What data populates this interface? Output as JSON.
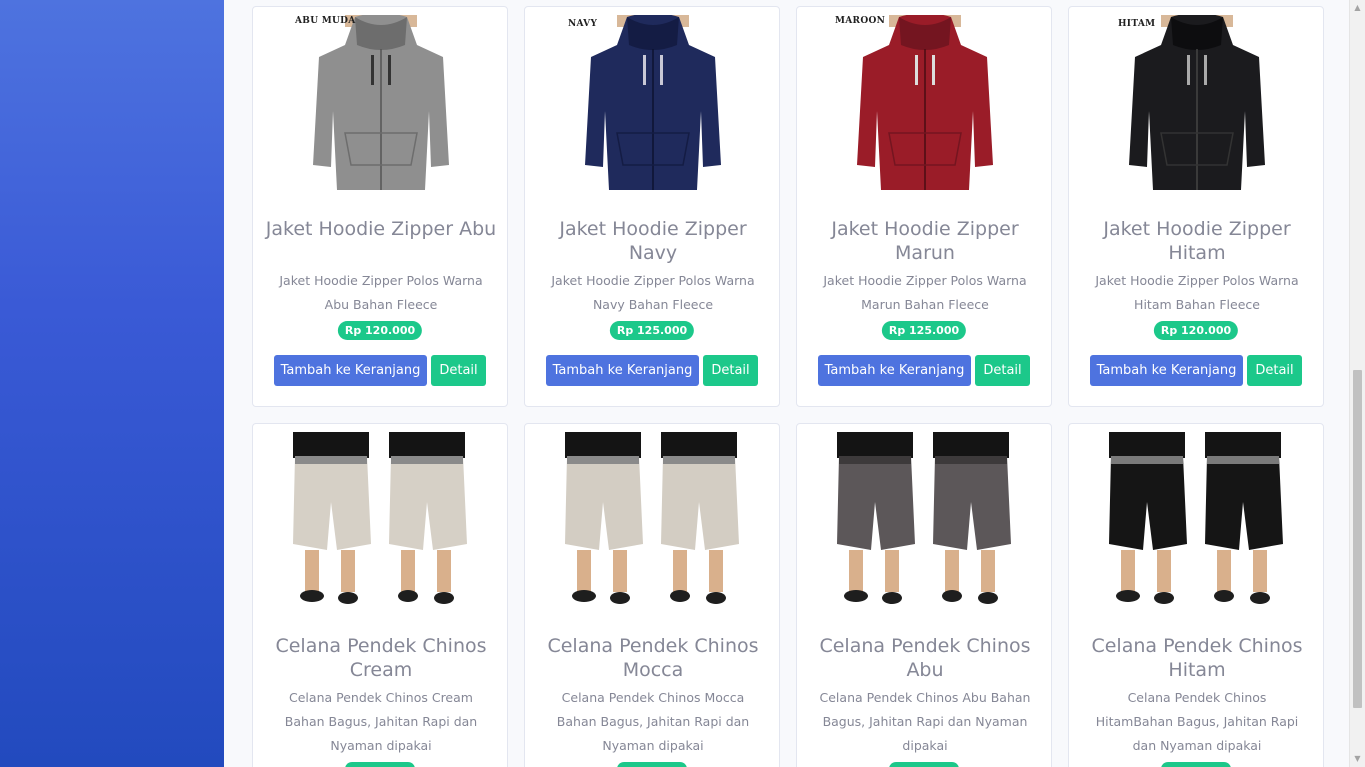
{
  "products_row1": [
    {
      "color_label": "ABU MUDA",
      "title": "Jaket Hoodie Zipper Abu",
      "desc": "Jaket Hoodie Zipper Polos Warna Abu Bahan Fleece",
      "price": "Rp 120.000",
      "hoodie_color": "#8f8f8f",
      "hoodie_shade": "#6d6d6d"
    },
    {
      "color_label": "NAVY",
      "title": "Jaket Hoodie Zipper Navy",
      "desc": "Jaket Hoodie Zipper Polos Warna Navy Bahan Fleece",
      "price": "Rp 125.000",
      "hoodie_color": "#1f2a5c",
      "hoodie_shade": "#141c44"
    },
    {
      "color_label": "MAROON",
      "title": "Jaket Hoodie Zipper Marun",
      "desc": "Jaket Hoodie Zipper Polos Warna Marun Bahan Fleece",
      "price": "Rp 125.000",
      "hoodie_color": "#9a1c28",
      "hoodie_shade": "#741520"
    },
    {
      "color_label": "HITAM",
      "title": "Jaket Hoodie Zipper Hitam",
      "desc": "Jaket Hoodie Zipper Polos Warna Hitam Bahan Fleece",
      "price": "Rp 120.000",
      "hoodie_color": "#1b1b1e",
      "hoodie_shade": "#0d0d0f"
    }
  ],
  "products_row2": [
    {
      "title": "Celana Pendek Chinos Cream",
      "desc": "Celana Pendek Chinos Cream Bahan Bagus, Jahitan Rapi dan Nyaman dipakai",
      "shorts_color": "#d6d0c6"
    },
    {
      "title": "Celana Pendek Chinos Mocca",
      "desc": "Celana Pendek Chinos Mocca Bahan Bagus, Jahitan Rapi dan Nyaman dipakai",
      "shorts_color": "#d3cdc3"
    },
    {
      "title": "Celana Pendek Chinos Abu",
      "desc": "Celana Pendek Chinos Abu Bahan Bagus, Jahitan Rapi dan Nyaman dipakai",
      "shorts_color": "#5c5759"
    },
    {
      "title": "Celana Pendek Chinos Hitam",
      "desc": "Celana Pendek Chinos HitamBahan Bagus, Jahitan Rapi dan Nyaman dipakai",
      "shorts_color": "#151515"
    }
  ],
  "buttons": {
    "add_to_cart": "Tambah ke Keranjang",
    "detail": "Detail"
  },
  "colors": {
    "sidebar": "#4e73df",
    "primary": "#4e73df",
    "success": "#1cc88a",
    "text_muted": "#858796"
  }
}
